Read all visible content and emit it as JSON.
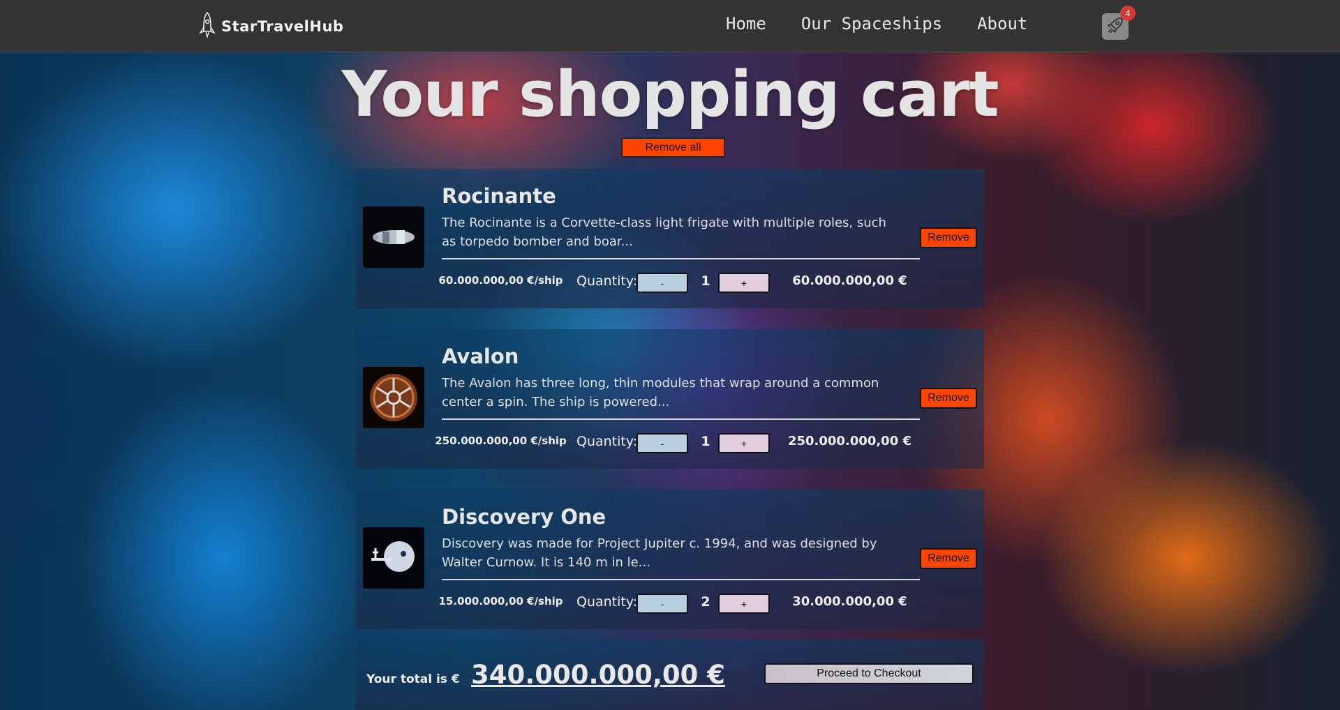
{
  "navbar": {
    "brand": "StarTravelHub",
    "links": [
      "Home",
      "Our Spaceships",
      "About"
    ],
    "cart_count": "4"
  },
  "page": {
    "title": "Your shopping cart",
    "remove_all_label": "Remove all"
  },
  "cart": {
    "quantity_label": "Quantity:",
    "minus_label": "-",
    "plus_label": "+",
    "remove_label": "Remove",
    "items": [
      {
        "name": "Rocinante",
        "description": "The Rocinante is a Corvette-class light frigate with multiple roles, such as torpedo bomber and boar...",
        "unit_price": "60.000.000,00 €/ship",
        "quantity": "1",
        "line_total": "60.000.000,00 €",
        "image": "spaceship-photo"
      },
      {
        "name": "Avalon",
        "description": "The Avalon has three long, thin modules that wrap around a common center a spin. The ship is powered...",
        "unit_price": "250.000.000,00 €/ship",
        "quantity": "1",
        "line_total": "250.000.000,00 €",
        "image": "spaceship-photo"
      },
      {
        "name": "Discovery One",
        "description": "Discovery was made for Project Jupiter c. 1994, and was designed by Walter Curnow. It is 140 m in le...",
        "unit_price": "15.000.000,00 €/ship",
        "quantity": "2",
        "line_total": "30.000.000,00 €",
        "image": "spaceship-photo"
      }
    ]
  },
  "total": {
    "label": "Your total is €",
    "value": "340.000.000,00 €",
    "checkout_label": "Proceed to Checkout"
  },
  "colors": {
    "navbar": "#333333",
    "remove_button": "#ff4500",
    "badge": "#d33b3b"
  }
}
